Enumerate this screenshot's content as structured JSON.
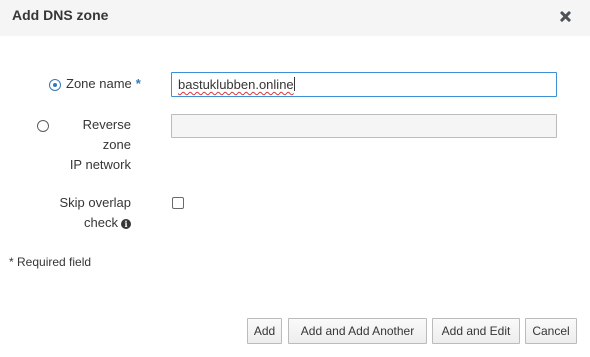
{
  "dialog": {
    "title": "Add DNS zone",
    "close_icon": "close-icon"
  },
  "form": {
    "zone_name": {
      "label": "Zone name",
      "required_mark": "*",
      "value": "bastuklubben.online",
      "selected": true
    },
    "reverse_zone": {
      "label_line1": "Reverse zone",
      "label_line2": "IP network",
      "value": "",
      "selected": false
    },
    "skip_overlap": {
      "label_line1": "Skip overlap",
      "label_line2": "check",
      "info_icon": "info-icon",
      "checked": false
    },
    "required_note": "* Required field"
  },
  "footer": {
    "buttons": [
      "Add",
      "Add and Add Another",
      "Add and Edit",
      "Cancel"
    ]
  },
  "colors": {
    "accent": "#3778b8",
    "focus_border": "#3d8fd6",
    "header_bg": "#f5f5f5"
  }
}
